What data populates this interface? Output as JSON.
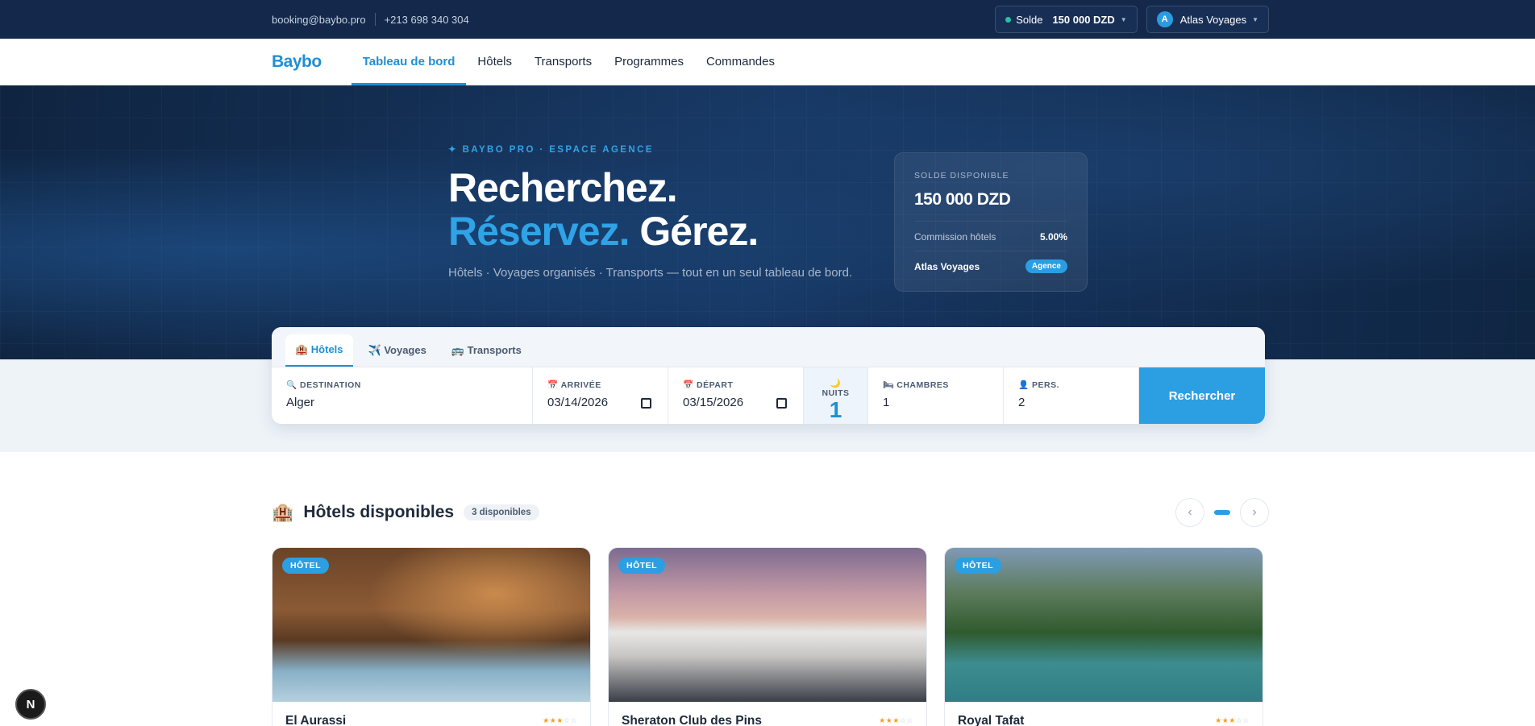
{
  "topbar": {
    "email": "booking@baybo.pro",
    "phone": "+213 698 340 304",
    "balance_label": "Solde",
    "balance_value": "150 000 DZD",
    "agency_initial": "A",
    "agency_name": "Atlas Voyages"
  },
  "nav": {
    "logo": "Baybo",
    "items": [
      "Tableau de bord",
      "Hôtels",
      "Transports",
      "Programmes",
      "Commandes"
    ],
    "active": "Tableau de bord"
  },
  "hero": {
    "eyebrow": "✦ BAYBO PRO · ESPACE AGENCE",
    "title_line1": "Recherchez.",
    "title_blue": "Réservez.",
    "title_rest": " Gérez.",
    "subtitle": "Hôtels · Voyages organisés · Transports — tout en un seul tableau de bord."
  },
  "balance_card": {
    "label": "SOLDE DISPONIBLE",
    "amount": "150 000 DZD",
    "commission_label": "Commission hôtels",
    "commission_value": "5.00%",
    "agency": "Atlas Voyages",
    "badge": "Agence"
  },
  "search": {
    "tabs": [
      "🏨 Hôtels",
      "✈️ Voyages",
      "🚌 Transports"
    ],
    "active_tab": "🏨 Hôtels",
    "destination_label": "🔍 DESTINATION",
    "destination_value": "Alger",
    "arrival_label": "📅 ARRIVÉE",
    "arrival_value": "03/14/2026",
    "departure_label": "📅 DÉPART",
    "departure_value": "03/15/2026",
    "nights_label": "🌙 NUITS",
    "nights_value": "1",
    "rooms_label": "🛏 CHAMBRES",
    "rooms_value": "1",
    "persons_label": "👤 PERS.",
    "persons_value": "2",
    "button": "Rechercher"
  },
  "hotels_section": {
    "emoji": "🏨",
    "title": "Hôtels disponibles",
    "count": "3 disponibles",
    "prev": "‹",
    "next": "›"
  },
  "hotels": [
    {
      "tag": "HÔTEL",
      "name": "El Aurassi",
      "stars": 3
    },
    {
      "tag": "HÔTEL",
      "name": "Sheraton Club des Pins",
      "stars": 3
    },
    {
      "tag": "HÔTEL",
      "name": "Royal Tafat",
      "stars": 3
    }
  ],
  "colors": {
    "accent": "#2b9fe2",
    "topbar": "#13284a",
    "star": "#f29f2b"
  },
  "floating": {
    "label": "N"
  }
}
